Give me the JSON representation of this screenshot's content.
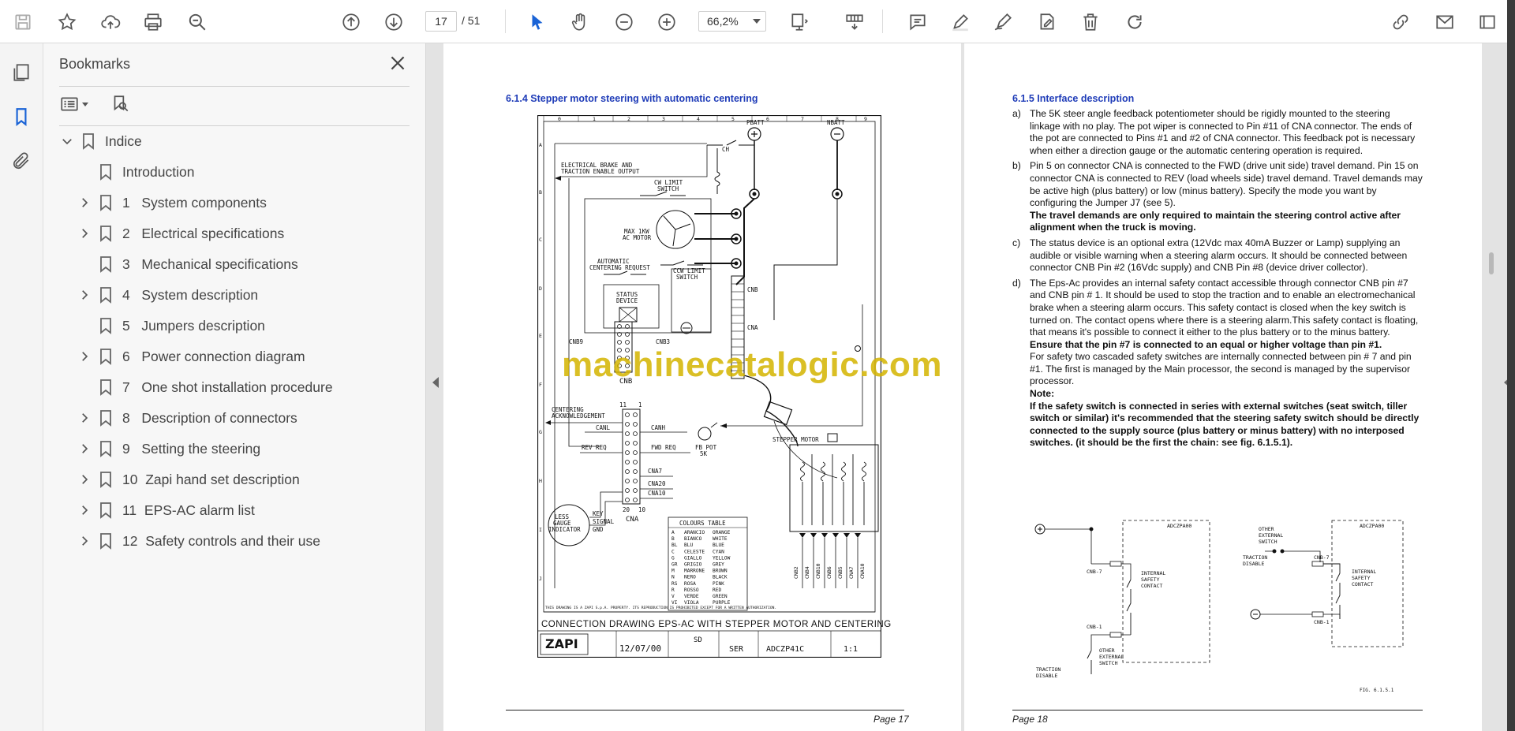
{
  "toolbar": {
    "page_current": "17",
    "page_total": "/ 51",
    "zoom": "66,2%"
  },
  "bookmarks": {
    "title": "Bookmarks",
    "items": [
      {
        "label": "Indice",
        "expanded": true,
        "level": 0
      },
      {
        "label": "Introduction",
        "level": 1,
        "has_children": false
      },
      {
        "label": "1   System components",
        "level": 1,
        "has_children": true
      },
      {
        "label": "2   Electrical specifications",
        "level": 1,
        "has_children": true
      },
      {
        "label": "3   Mechanical specifications",
        "level": 1,
        "has_children": false
      },
      {
        "label": "4   System description",
        "level": 1,
        "has_children": true
      },
      {
        "label": "5   Jumpers description",
        "level": 1,
        "has_children": false
      },
      {
        "label": "6   Power connection diagram",
        "level": 1,
        "has_children": true
      },
      {
        "label": "7   One shot installation procedure",
        "level": 1,
        "has_children": false
      },
      {
        "label": "8   Description of connectors",
        "level": 1,
        "has_children": true
      },
      {
        "label": "9   Setting the steering",
        "level": 1,
        "has_children": true
      },
      {
        "label": "10  Zapi hand set description",
        "level": 1,
        "has_children": true
      },
      {
        "label": "11  EPS-AC alarm list",
        "level": 1,
        "has_children": true
      },
      {
        "label": "12  Safety controls and their use",
        "level": 1,
        "has_children": true
      }
    ]
  },
  "page17": {
    "heading": "6.1.4 Stepper motor steering with automatic centering",
    "footer": "Page 17",
    "drawing": {
      "title": "CONNECTION DRAWING EPS-AC WITH STEPPER MOTOR AND CENTERING",
      "labels": {
        "pbatt": "PBATT",
        "nbatt": "NBATT",
        "ch": "CH",
        "brake": "ELECTRICAL BRAKE AND",
        "brake2": "TRACTION ENABLE OUTPUT",
        "cw": "CW LIMIT",
        "cw2": "SWITCH",
        "motor": "MAX 1KW",
        "motor2": "AC MOTOR",
        "auto": "AUTOMATIC",
        "auto2": "CENTERING REQUEST",
        "ccw": "CCW LIMIT",
        "ccw2": "SWITCH",
        "status": "STATUS",
        "status2": "DEVICE",
        "cnb": "CNB",
        "cna": "CNA",
        "centering": "CENTERING",
        "ack": "ACKNOWLEDGEMENT",
        "canl": "CANL",
        "canh": "CANH",
        "revreq": "REV REQ",
        "fwdreq": "FWD REQ",
        "cna7": "CNA7",
        "cna20": "CNA20",
        "cna10": "CNA10",
        "fbpot": "FB POT",
        "fbpot2": "5K",
        "stepper": "STEPPER MOTOR",
        "gauge": "INDICATOR",
        "key": "KEY",
        "signal": "SIGNAL",
        "gnd": "GND",
        "colours": "COLOURS TABLE"
      },
      "colours": [
        [
          "A",
          "ARANCIO",
          "ORANGE"
        ],
        [
          "B",
          "BIANCO",
          "WHITE"
        ],
        [
          "BL",
          "BLU",
          "BLUE"
        ],
        [
          "C",
          "CELESTE",
          "CYAN"
        ],
        [
          "G",
          "GIALLO",
          "YELLOW"
        ],
        [
          "GR",
          "GRIGIO",
          "GREY"
        ],
        [
          "M",
          "MARRONE",
          "BROWN"
        ],
        [
          "N",
          "NERO",
          "BLACK"
        ],
        [
          "RS",
          "ROSA",
          "PINK"
        ],
        [
          "R",
          "ROSSO",
          "RED"
        ],
        [
          "V",
          "VERDE",
          "GREEN"
        ],
        [
          "VI",
          "VIOLA",
          "PURPLE"
        ]
      ],
      "date": "12/07/00",
      "tech": "SD",
      "series": "SER",
      "drawing_no": "ADCZP41C",
      "pages": "1:1",
      "company": "ZAPI"
    }
  },
  "page18": {
    "heading": "6.1.5 Interface description",
    "footer": "Page 18",
    "items": [
      {
        "label": "a)",
        "text": "The 5K steer angle feedback potentiometer should be rigidly mounted to the steering linkage with no play. The pot wiper is connected to Pin #11 of CNA connector. The ends of the pot are connected to Pins #1 and #2 of CNA connector. This feedback pot is necessary when either a direction gauge or the automatic centering operation is required."
      },
      {
        "label": "b)",
        "text": "Pin 5 on connector CNA is connected to the FWD (drive unit side) travel demand. Pin 15 on connector CNA is connected to REV (load wheels side) travel demand. Travel demands may be active high (plus battery) or low (minus battery). Specify the mode you want by configuring the Jumper J7 (see 5).",
        "bold": "The travel demands are only required to maintain the steering control active after alignment when the truck is moving."
      },
      {
        "label": "c)",
        "text": "The status device is an optional extra (12Vdc max 40mA Buzzer or Lamp) supplying an audible or visible warning when a steering alarm occurs. It should be connected between connector CNB Pin #2 (16Vdc supply) and CNB Pin #8 (device driver collector)."
      },
      {
        "label": "d)",
        "text": "The Eps-Ac provides an internal safety contact accessible through connector CNB pin #7 and CNB pin # 1. It should be used to stop the traction and to enable an electromechanical brake when a steering alarm occurs. This safety contact is closed when the key switch is turned on. The contact opens where there is a steering alarm.This safety contact is floating, that means it's possible to connect it either to the plus battery or to the minus battery.",
        "bold": "Ensure that the pin #7 is connected to an equal or higher voltage than pin #1.",
        "text2": "For safety two cascaded safety switches are internally connected between pin # 7 and pin #1. The first is managed by the Main processor, the second is managed by the supervisor processor."
      }
    ],
    "note_title": "Note:",
    "note": "If the safety switch is connected in series with external switches (seat switch, tiller switch or similar) it's recommended that the steering safety switch should be directly connected to the supply source (plus battery or minus battery) with no interposed switches. (it should be the first the chain: see fig. 6.1.5.1).",
    "fig": {
      "left_title": "ADCZPA00",
      "right_title": "ADCZPA00",
      "cnb7": "CNB-7",
      "cnb1": "CNB-1",
      "internal": "INTERNAL",
      "internal2": "SAFETY",
      "internal3": "CONTACT",
      "other": "OTHER",
      "other2": "EXTERNAL",
      "other3": "SWITCH",
      "traction": "TRACTION",
      "traction2": "DISABLE",
      "fig_label": "FIG. 6.1.5.1"
    }
  },
  "watermark": "machinecatalogic.com"
}
